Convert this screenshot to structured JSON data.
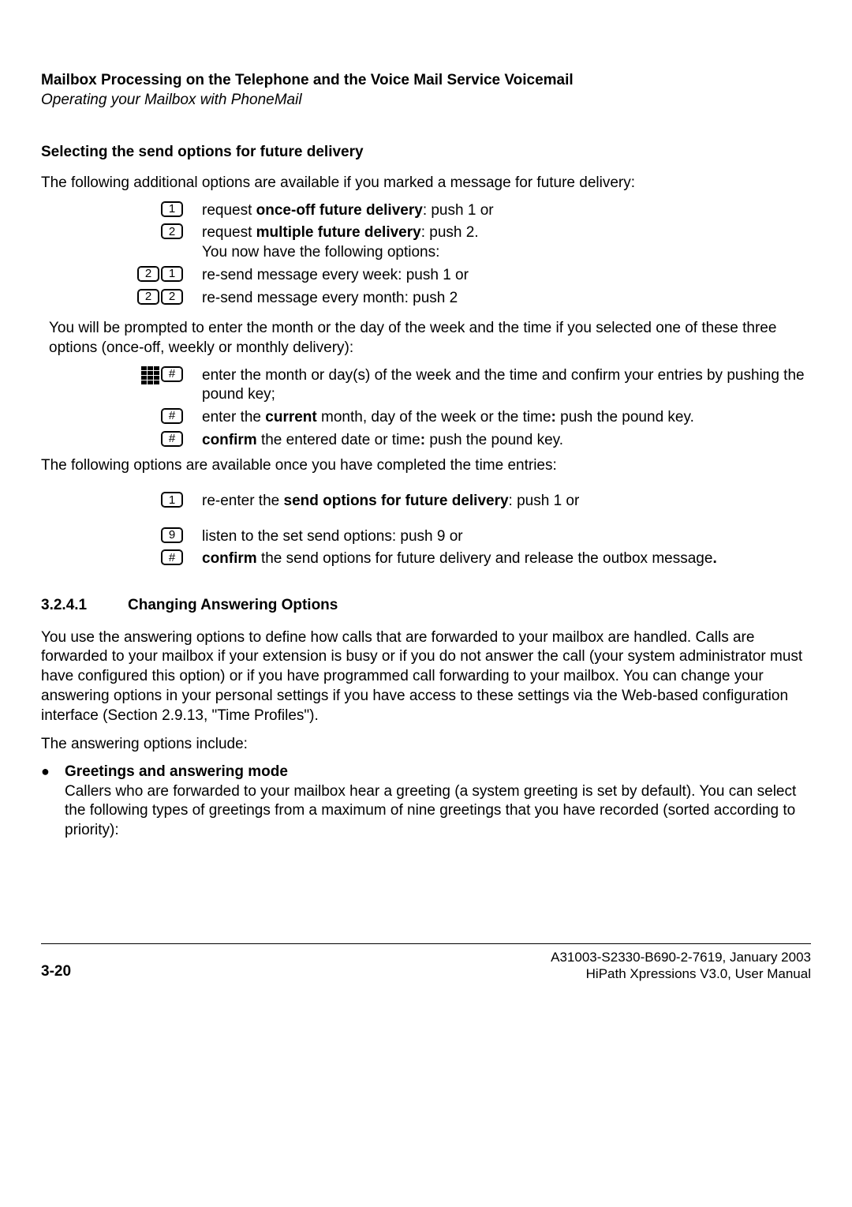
{
  "header": {
    "title": "Mailbox Processing on the Telephone and the Voice Mail Service Voicemail",
    "subtitle": "Operating your Mailbox with PhoneMail"
  },
  "s1": {
    "heading": "Selecting the send options for future delivery",
    "intro": "The following additional options are available if you marked a message for future delivery:",
    "r1_a": "request ",
    "r1_b": "once-off future delivery",
    "r1_c": ": push 1 or",
    "r2_a": "request ",
    "r2_b": "multiple future delivery",
    "r2_c": ": push 2.",
    "r2_d": "You now have the following options:",
    "r3": "re-send message every week: push 1 or",
    "r4": "re-send message every month: push 2",
    "prompt": "You will be prompted to enter the month or the day of the week and the time if you selected one of these three options (once-off, weekly or monthly delivery):",
    "r5": "enter the month or day(s) of the week and the time and confirm your entries by pushing the pound key;",
    "r6_a": "enter the ",
    "r6_b": "current",
    "r6_c": " month, day of the week or the time",
    "r6_d": ": ",
    "r6_e": "push the pound key.",
    "r7_a": "confirm",
    "r7_b": " the entered date or time",
    "r7_c": ": ",
    "r7_d": "push the pound key.",
    "after": "The following options are available once you have completed the time entries:",
    "r8_a": "re-enter the ",
    "r8_b": "send options for future delivery",
    "r8_c": ": push 1 or",
    "r9": "listen to the set send options: push 9 or",
    "r10_a": "confirm",
    "r10_b": " the send options for future delivery and release the outbox message",
    "r10_c": "."
  },
  "s2": {
    "num": "3.2.4.1",
    "title": "Changing Answering Options",
    "p1": "You use the answering options to define how calls that are forwarded to your mailbox are handled. Calls are forwarded to your mailbox if your extension is busy or if you do not answer the call (your system administrator must have configured this option) or if you have programmed call forwarding to your mailbox. You can change your answering options in your personal settings if you have access to these settings via the Web-based configuration interface (Section 2.9.13, \"Time Profiles\").",
    "p2": "The answering options include:",
    "b1_title": "Greetings and answering mode",
    "b1_body": "Callers who are forwarded to your mailbox hear a greeting (a system greeting is set by default). You can select the following types of greetings from a maximum of nine greetings that you have recorded (sorted according to priority):"
  },
  "keys": {
    "k1": "1",
    "k2": "2",
    "k9": "9",
    "hash": "#"
  },
  "footer": {
    "page": "3-20",
    "line1": "A31003-S2330-B690-2-7619, January 2003",
    "line2": "HiPath Xpressions V3.0, User Manual"
  }
}
